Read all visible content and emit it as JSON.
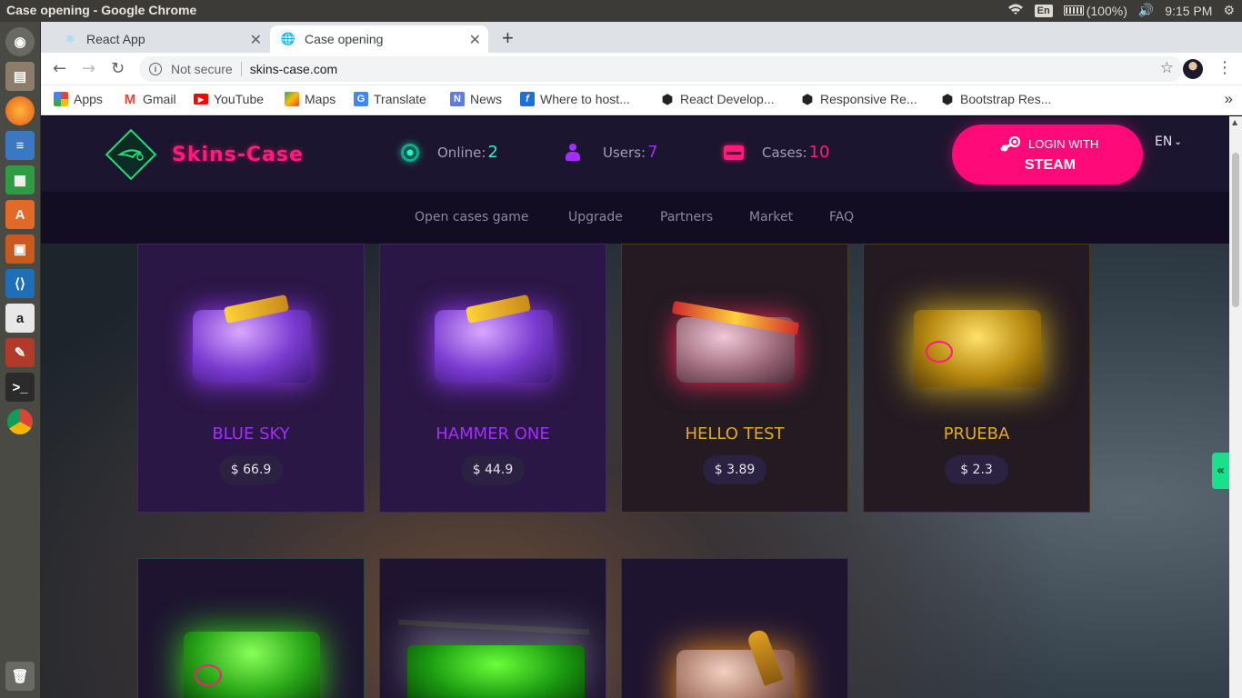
{
  "os": {
    "window_title": "Case opening - Google Chrome",
    "keyboard_layout": "En",
    "battery": "(100%)",
    "clock": "9:15 PM"
  },
  "browser": {
    "tabs": [
      {
        "title": "React App",
        "icon": "react-icon",
        "active": false
      },
      {
        "title": "Case opening",
        "icon": "globe-icon",
        "active": true
      }
    ],
    "new_tab_symbol": "+",
    "security_label": "Not secure",
    "url": "skins-case.com",
    "bookmarks": [
      {
        "label": "Apps",
        "icon": "apps-grid-icon"
      },
      {
        "label": "Gmail",
        "icon": "gmail-icon"
      },
      {
        "label": "YouTube",
        "icon": "youtube-icon"
      },
      {
        "label": "Maps",
        "icon": "maps-icon"
      },
      {
        "label": "Translate",
        "icon": "translate-icon"
      },
      {
        "label": "News",
        "icon": "news-icon"
      },
      {
        "label": "Where to host...",
        "icon": "f-icon"
      },
      {
        "label": "React Develop...",
        "icon": "codepen-icon"
      },
      {
        "label": "Responsive Re...",
        "icon": "codepen-icon"
      },
      {
        "label": "Bootstrap Res...",
        "icon": "codepen-icon"
      }
    ],
    "more_bookmarks": "»"
  },
  "site": {
    "logo_text": "Skins-Case",
    "stats": [
      {
        "label": "Online:",
        "value": "2",
        "color": "#2ef0c8",
        "icon": "online-icon"
      },
      {
        "label": "Users:",
        "value": "7",
        "color": "#a52bff",
        "icon": "user-icon"
      },
      {
        "label": "Cases:",
        "value": "10",
        "color": "#ff1a7c",
        "icon": "case-icon"
      }
    ],
    "login": {
      "line1": "LOGIN WITH",
      "line2": "STEAM"
    },
    "language": "EN",
    "nav": [
      "Open cases game",
      "Upgrade",
      "Partners",
      "Market",
      "FAQ"
    ],
    "side_toggle": "«",
    "cases": [
      {
        "name": "BLUE SKY",
        "price": "$ 66.9",
        "theme": "purple"
      },
      {
        "name": "HAMMER ONE",
        "price": "$ 44.9",
        "theme": "purple"
      },
      {
        "name": "HELLO TEST",
        "price": "$ 3.89",
        "theme": "red"
      },
      {
        "name": "PRUEBA",
        "price": "$ 2.3",
        "theme": "gold"
      },
      {
        "name": "",
        "price": "",
        "theme": "green"
      },
      {
        "name": "",
        "price": "",
        "theme": "green-long"
      },
      {
        "name": "",
        "price": "",
        "theme": "orange"
      }
    ]
  }
}
